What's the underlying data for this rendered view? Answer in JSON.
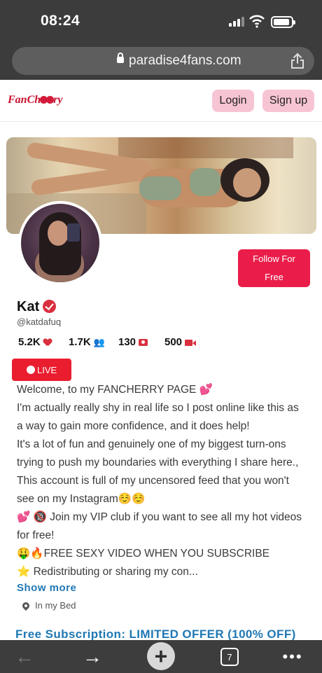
{
  "status_bar": {
    "time": "08:24"
  },
  "browser": {
    "url": "paradise4fans.com"
  },
  "site_header": {
    "logo_text_1": "FanCh",
    "logo_text_2": "ry",
    "login_label": "Login",
    "signup_label": "Sign up"
  },
  "profile": {
    "name": "Kat",
    "handle": "@katdafuq",
    "follow_label_1": "Follow For",
    "follow_label_2": "Free",
    "stats": [
      {
        "value": "5.2K",
        "icon": "heart-icon"
      },
      {
        "value": "1.7K",
        "icon": "users-icon"
      },
      {
        "value": "130",
        "icon": "camera-icon"
      },
      {
        "value": "500",
        "icon": "video-icon"
      }
    ],
    "live_label": "LIVE",
    "bio": [
      "Welcome, to my FANCHERRY PAGE 💕",
      "I'm actually really shy in real life so I post online like this as",
      "a way to gain more confidence, and it does help!",
      "It's a lot of fun and genuinely one of my biggest turn-ons",
      "trying to push my boundaries with everything I share here.,",
      "This account is full of my uncensored feed that you won't",
      "see on my Instagram☺️☺️",
      "💕 🔞 Join my VIP club if you want to see all my hot videos",
      "for free!",
      "🤑🔥FREE SEXY VIDEO WHEN YOU SUBSCRIBE",
      "⭐ Redistributing or sharing my con..."
    ],
    "show_more_label": "Show more",
    "location": "In my Bed",
    "promo": "Free Subscription: LIMITED OFFER (100% OFF)"
  },
  "bottom_bar": {
    "back_icon": "←",
    "forward_icon": "→",
    "new_tab_icon": "+",
    "tab_count": "7",
    "more_icon": "•••"
  }
}
